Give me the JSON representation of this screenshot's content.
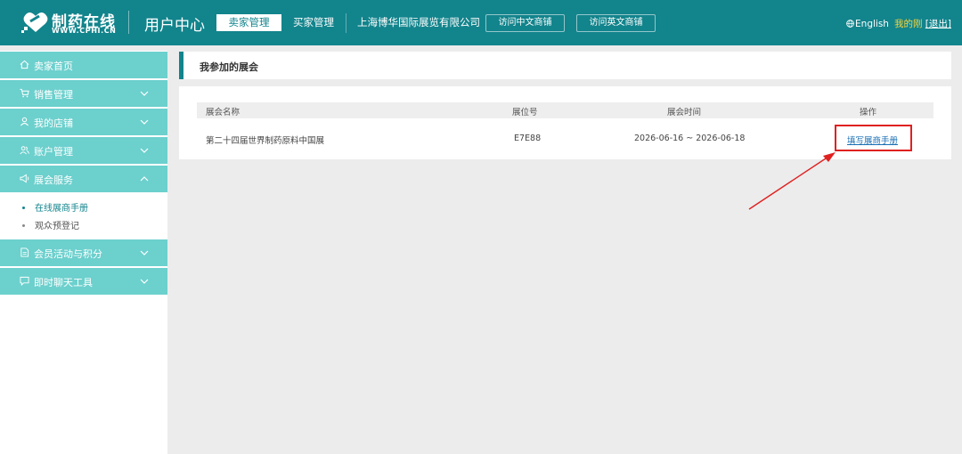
{
  "header": {
    "logo_main": "制药在线",
    "logo_sub": "WWW.CPHI.CN",
    "title": "用户中心",
    "nav": [
      "卖家管理",
      "买家管理",
      "上海博华国际展览有限公司"
    ],
    "visit_buttons": [
      "访问中文商铺",
      "访问英文商铺"
    ],
    "language": "English",
    "user": "我的刚",
    "logout": "[退出]"
  },
  "sidebar": {
    "items": [
      {
        "label": "卖家首页",
        "icon": "home-icon",
        "chevron": null
      },
      {
        "label": "销售管理",
        "icon": "cart-icon",
        "chevron": "down"
      },
      {
        "label": "我的店铺",
        "icon": "person-icon",
        "chevron": "down"
      },
      {
        "label": "账户管理",
        "icon": "users-icon",
        "chevron": "down"
      },
      {
        "label": "展会服务",
        "icon": "megaphone-icon",
        "chevron": "up"
      }
    ],
    "subitems": [
      {
        "label": "在线展商手册",
        "active": true
      },
      {
        "label": "观众预登记",
        "active": false
      }
    ],
    "items_after": [
      {
        "label": "会员活动与积分",
        "icon": "document-icon",
        "chevron": "down"
      },
      {
        "label": "即时聊天工具",
        "icon": "chat-icon",
        "chevron": "down"
      }
    ]
  },
  "main": {
    "panel_title": "我参加的展会",
    "table": {
      "headers": [
        "展会名称",
        "展位号",
        "展会时间",
        "操作"
      ],
      "rows": [
        {
          "name": "第二十四届世界制药原料中国展",
          "booth": "E7E88",
          "time": "2026-06-16 ~ 2026-06-18",
          "action": "填写展商手册"
        }
      ]
    }
  },
  "colors": {
    "header": "#12848c",
    "sidebar_item": "#6cd0cd",
    "accent_yellow": "#f5d33b",
    "annotation_red": "#e02020"
  }
}
